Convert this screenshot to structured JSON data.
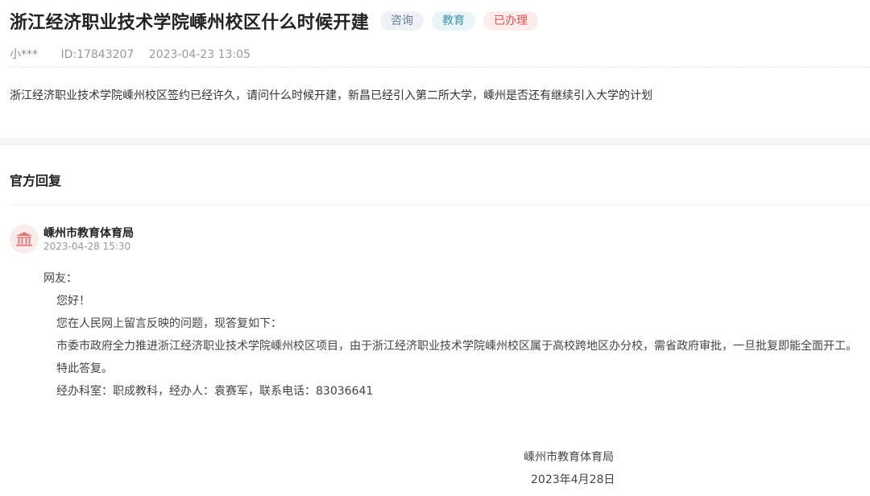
{
  "question": {
    "title": "浙江经济职业技术学院嵊州校区什么时候开建",
    "tags": [
      "咨询",
      "教育",
      "已办理"
    ],
    "author": "小***",
    "id": "ID:17843207",
    "time": "2023-04-23 13:05",
    "content": "浙江经济职业技术学院嵊州校区签约已经许久，请问什么时候开建，新昌已经引入第二所大学，嵊州是否还有继续引入大学的计划"
  },
  "reply": {
    "section_title": "官方回复",
    "office": "嵊州市教育体育局",
    "time": "2023-04-28 15:30",
    "lines": [
      "网友：",
      "您好！",
      "您在人民网上留言反映的问题，现答复如下：",
      "市委市政府全力推进浙江经济职业技术学院嵊州校区项目，由于浙江经济职业技术学院嵊州校区属于高校跨地区办分校，需省政府审批，一旦批复即能全面开工。",
      "特此答复。",
      "经办科室：职成教科，经办人：袁赛军，联系电话：83036641"
    ],
    "signature_office": "嵊州市教育体育局",
    "signature_date": "2023年4月28日"
  },
  "icons": {
    "avatar": "government-building-icon"
  },
  "colors": {
    "tag_consult": "#6b7d95",
    "tag_edu": "#3b8fb0",
    "tag_done": "#d9534f",
    "avatar_icon": "#e07b7b"
  }
}
